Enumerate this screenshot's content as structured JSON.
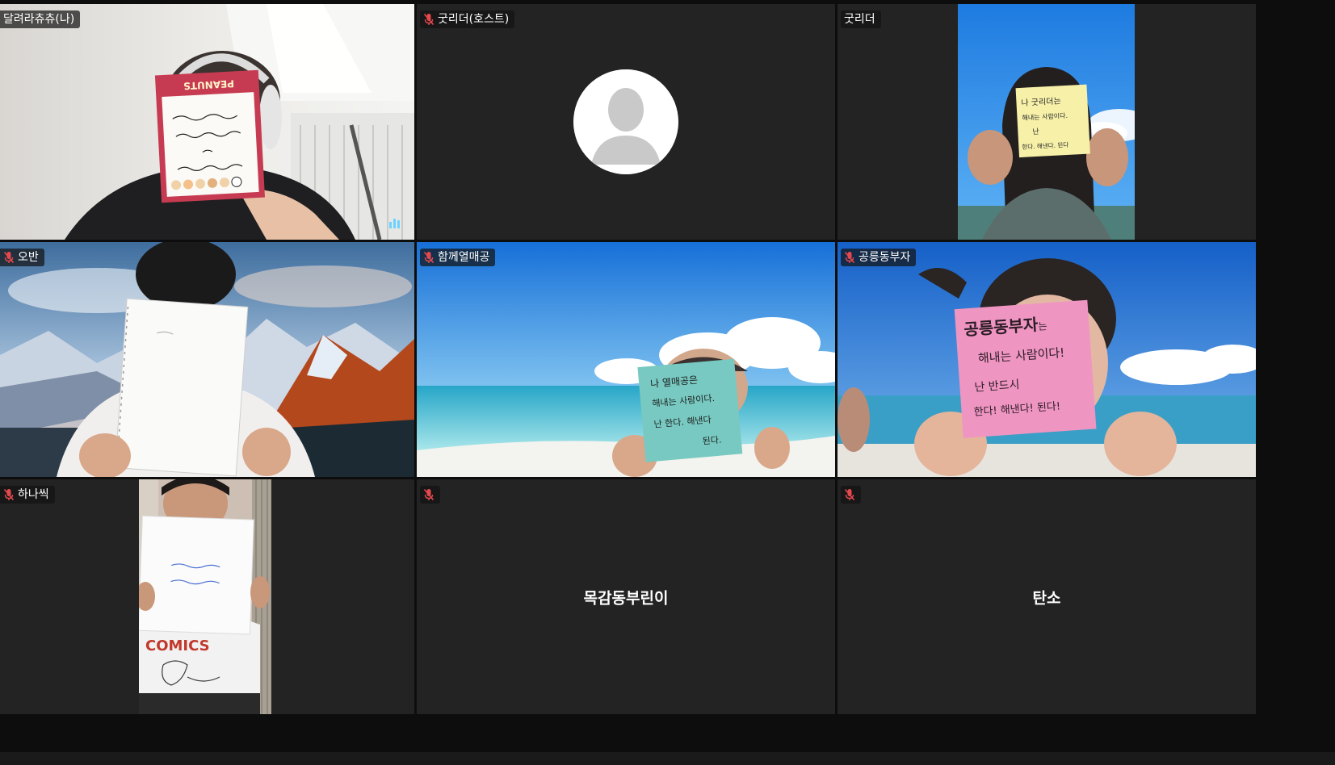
{
  "participants": {
    "p1": {
      "name": "달려라츄츄(나)",
      "muted": false,
      "speaking": true
    },
    "p2": {
      "name": "굿리더(호스트)",
      "muted": true
    },
    "p3": {
      "name": "굿리더",
      "muted": false
    },
    "p4": {
      "name": "오반",
      "muted": true
    },
    "p5": {
      "name": "함께열매공",
      "muted": true
    },
    "p6": {
      "name": "공릉동부자",
      "muted": true
    },
    "p7": {
      "name": "하나씩",
      "muted": true
    },
    "p8": {
      "name": "목감동부린이",
      "muted": true
    },
    "p9": {
      "name": "탄소",
      "muted": true
    }
  },
  "notes": {
    "p6_note": {
      "line1": "공릉동부자",
      "suffix": "는",
      "line2": "해내는 사람이다!",
      "line3": "난 반드시",
      "line4": "한다! 해낸다! 된다!"
    },
    "p5_note": {
      "line1": "나 열매공은",
      "line2": "해내는 사람이다.",
      "line3": "난 한다. 해낸다",
      "line4": "된다."
    },
    "p3_note": {
      "line1": "나 굿리더는",
      "line2": "해내는 사람이다.",
      "line3": "난",
      "line4": "한다. 해낸다. 된다"
    },
    "p1_note": {
      "brand": "PEANUTS"
    },
    "p7_shirt": {
      "text": "COMICS"
    }
  },
  "colors": {
    "active_border": "#22d3a6",
    "tile_bg": "#232323",
    "muted_mic": "#e5484d"
  }
}
